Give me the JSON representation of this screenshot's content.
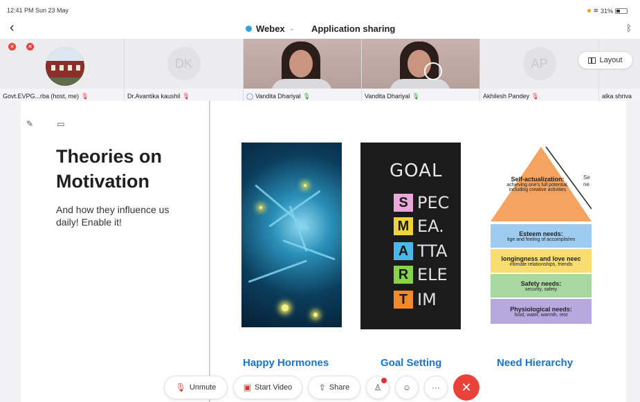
{
  "status": {
    "time": "12:41 PM  Sun 23 May",
    "battery": "31%"
  },
  "topbar": {
    "back_icon": "chevron-left-icon",
    "app": "Webex",
    "title": "Application sharing"
  },
  "participants": [
    {
      "name": "Govt.EVPG...rba (host, me)",
      "mic": "muted"
    },
    {
      "name": "Dr.Avantika kaushil",
      "initials": "DK",
      "mic": "muted"
    },
    {
      "name": "Vandita Dhariyal",
      "mic": "on",
      "active_speaker": true
    },
    {
      "name": "Vandita Dhariyal",
      "mic": "on"
    },
    {
      "name": "Akhilesh Pandey",
      "initials": "AP",
      "mic": "muted"
    },
    {
      "name": "alka shriva"
    }
  ],
  "layout_button": "Layout",
  "slide": {
    "title": "Theories on Motivation",
    "subtitle": "And how they influence us daily! Enable it!",
    "goal_image": {
      "heading": "GOAL",
      "rows": [
        {
          "letter": "S",
          "rest": "PEC",
          "color": "#e8a8d8"
        },
        {
          "letter": "M",
          "rest": "EA.",
          "color": "#f0d23a"
        },
        {
          "letter": "A",
          "rest": "TTA",
          "color": "#4ab8e8"
        },
        {
          "letter": "R",
          "rest": "ELE",
          "color": "#8ad24a"
        },
        {
          "letter": "T",
          "rest": "IM",
          "color": "#f08a2a"
        }
      ]
    },
    "pyramid": {
      "side_text_1": "Se",
      "side_text_2": "ne",
      "levels": [
        {
          "head": "Self-actualization:",
          "body": "achieving one's full potential, including creative activities",
          "color": "#f4a460"
        },
        {
          "head": "Esteem needs:",
          "body": "tige and feeling of accomplishm",
          "color": "#9ecbf0"
        },
        {
          "head": "longingness and love neec",
          "body": "intimate relationships, friends",
          "color": "#f7dc6f"
        },
        {
          "head": "Safety needs:",
          "body": "security, safety",
          "color": "#a8d8a0"
        },
        {
          "head": "Physiological needs:",
          "body": "food, water, warmth, rest",
          "color": "#b8a8e0"
        }
      ]
    },
    "captions": [
      "Happy Hormones",
      "Goal Setting",
      "Need Hierarchy"
    ]
  },
  "controls": {
    "unmute": "Unmute",
    "start_video": "Start Video",
    "share": "Share"
  },
  "colors": {
    "accent": "#1a73c8",
    "end": "#e8423b",
    "muted": "#e03030"
  }
}
